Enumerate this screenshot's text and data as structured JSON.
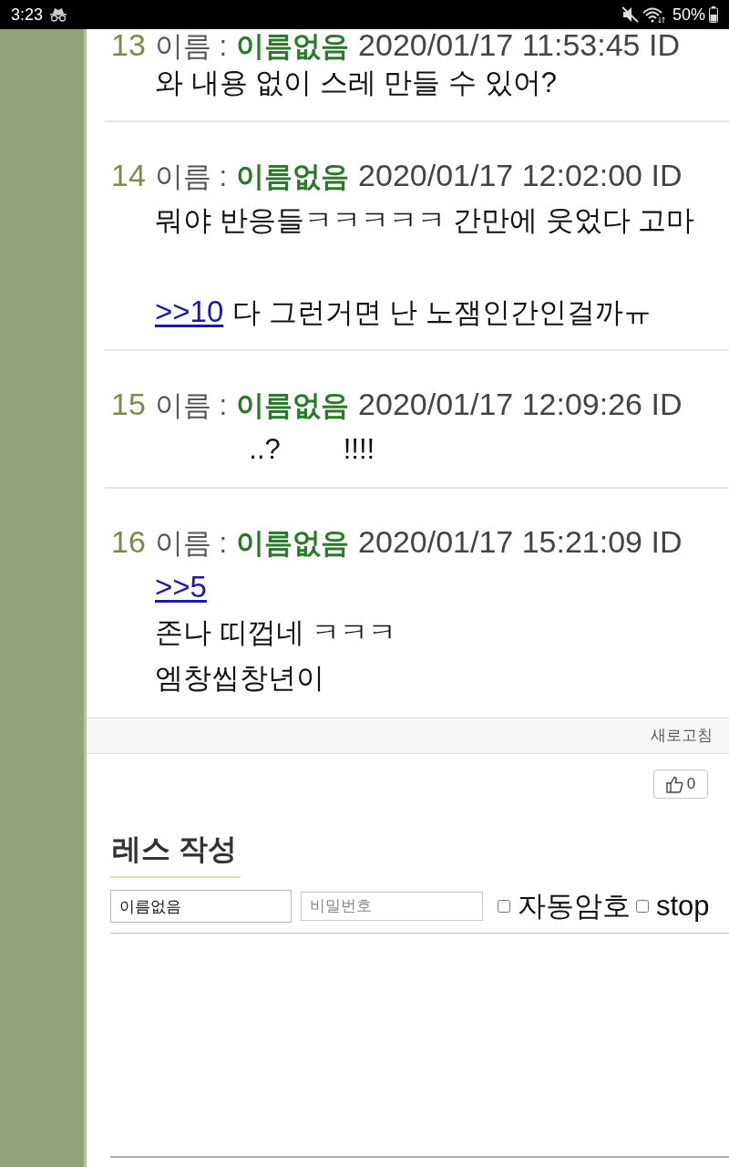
{
  "status_bar": {
    "time": "3:23",
    "battery": "50%"
  },
  "posts": [
    {
      "number": "13",
      "name_label": "이름 :",
      "name": "이름없음",
      "date": "2020/01/17 11:53:45 ID",
      "lines": [
        {
          "kind": "text",
          "text": "와 내용 없이 스레 만들 수 있어?"
        }
      ]
    },
    {
      "number": "14",
      "name_label": "이름 :",
      "name": "이름없음",
      "date": "2020/01/17 12:02:00 ID",
      "lines": [
        {
          "kind": "text",
          "text": "뭐야 반응들ㅋㅋㅋㅋㅋ 간만에 웃었다 고마"
        },
        {
          "kind": "break"
        },
        {
          "kind": "reply",
          "link": ">>10",
          "text": "다 그런거면 난 노잼인간인걸까ㅠ"
        }
      ]
    },
    {
      "number": "15",
      "name_label": "이름 :",
      "name": "이름없음",
      "date": "2020/01/17 12:09:26 ID",
      "lines": [
        {
          "kind": "text",
          "text": "            ..?        !!!!"
        }
      ]
    },
    {
      "number": "16",
      "name_label": "이름 :",
      "name": "이름없음",
      "date": "2020/01/17 15:21:09 ID",
      "lines": [
        {
          "kind": "reply",
          "link": ">>5"
        },
        {
          "kind": "text",
          "text": "존나 띠껍네 ㅋㅋㅋ"
        },
        {
          "kind": "text",
          "text": "엠창씹창년이"
        }
      ]
    }
  ],
  "refresh_bar": {
    "label": "새로고침"
  },
  "like_button": {
    "count": "0"
  },
  "reply_form": {
    "title": "레스 작성",
    "name_field": {
      "value": "이름없음"
    },
    "password_field": {
      "placeholder": "비밀번호"
    },
    "options": [
      {
        "label": "자동암호",
        "checked": false
      },
      {
        "label": "stop",
        "checked": false
      }
    ]
  }
}
